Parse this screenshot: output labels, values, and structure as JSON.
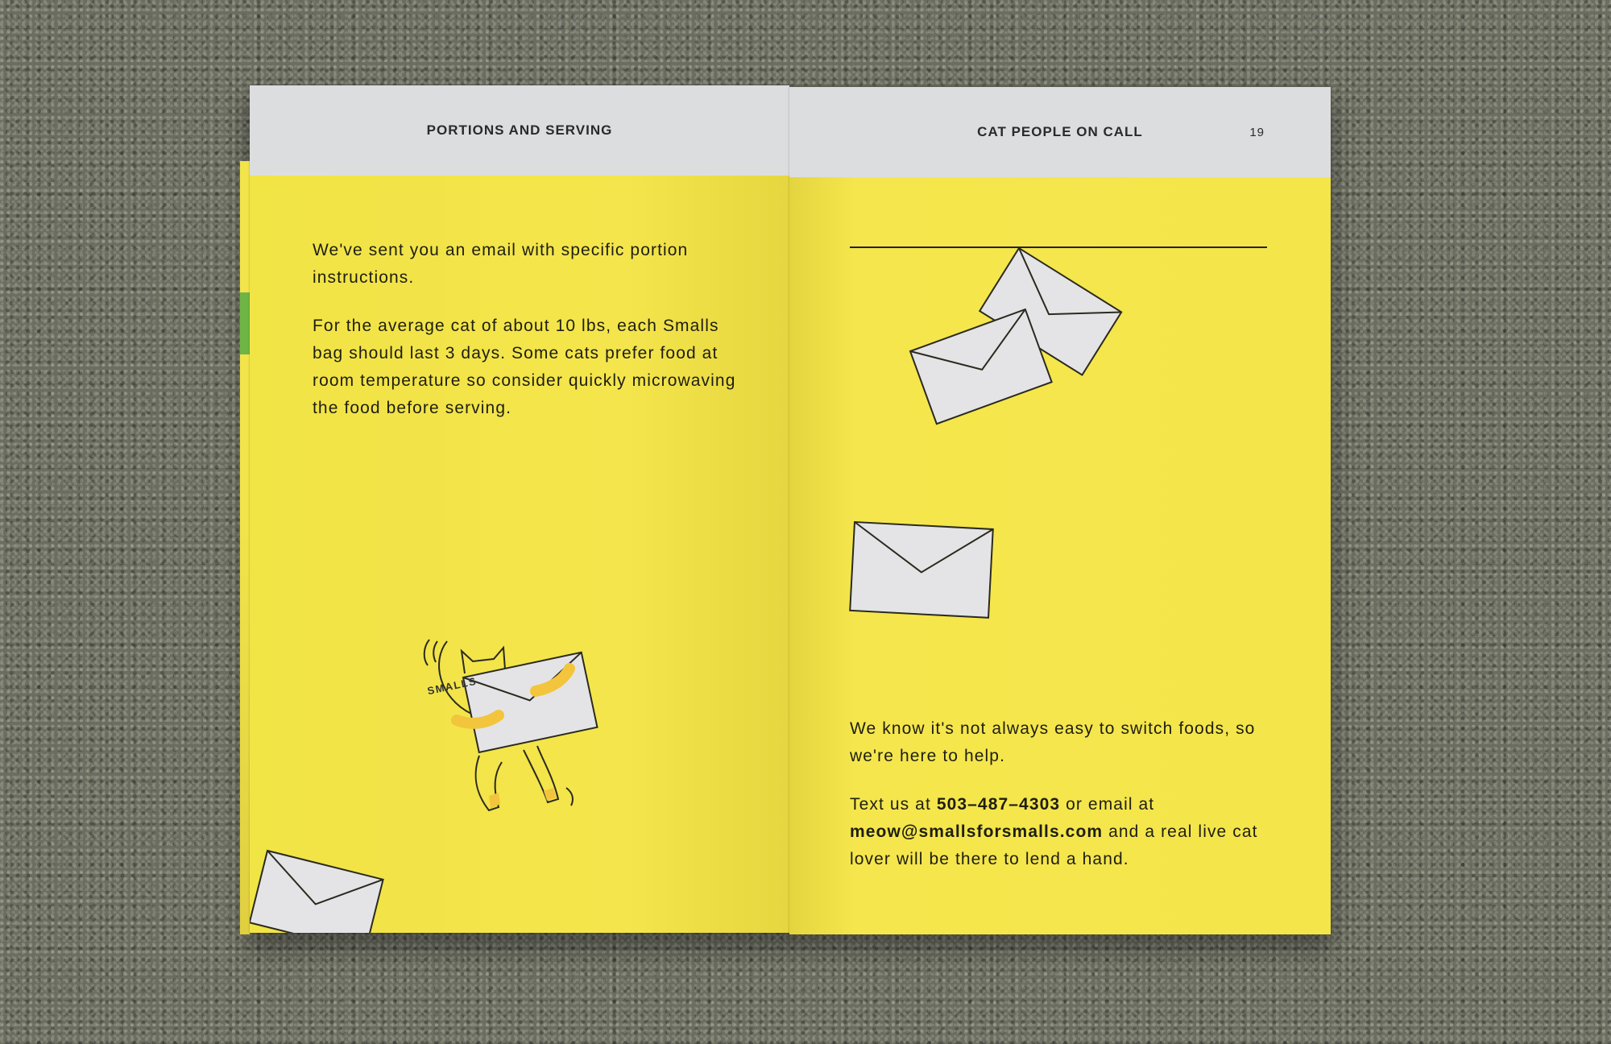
{
  "booklet": {
    "left_page": {
      "header": "PORTIONS AND SERVING",
      "paragraph_1": "We've sent you an email with specific portion instructions.",
      "paragraph_2": "For the average cat of about 10 lbs, each Smalls bag should last 3 days. Some cats prefer food at room temperature so consider quickly microwaving the food before serving.",
      "illustration_label": "SMALLS"
    },
    "right_page": {
      "header": "CAT PEOPLE ON CALL",
      "page_number": "19",
      "paragraph_1": "We know it's not always easy to switch foods, so we're here to help.",
      "contact_prefix": "Text us at ",
      "phone": "503–487–4303",
      "contact_mid": " or email at ",
      "email": "meow@smallsforsmalls.com",
      "contact_suffix": " and a real live cat lover will be there to lend a hand."
    }
  },
  "colors": {
    "page_yellow": "#f4e54a",
    "header_gray": "#dcdddf",
    "envelope_gray": "#e4e4e6",
    "background_gravel": "#6b6d5f"
  },
  "icons": [
    "envelope-icon",
    "cat-illustration"
  ]
}
